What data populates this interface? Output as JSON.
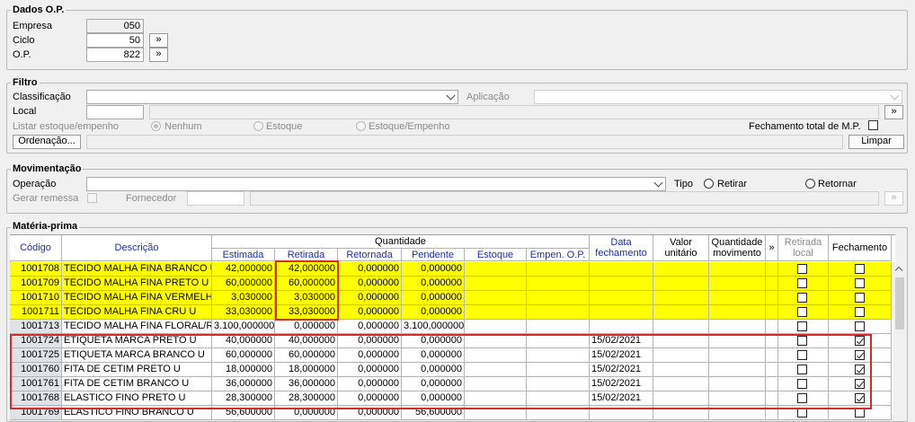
{
  "dados": {
    "title": "Dados O.P.",
    "empresa_label": "Empresa",
    "empresa_value": "050",
    "ciclo_label": "Ciclo",
    "ciclo_value": "50",
    "op_label": "O.P.",
    "op_value": "822",
    "more_label": "»"
  },
  "filtro": {
    "title": "Filtro",
    "classificacao_label": "Classificação",
    "aplicacao_label": "Aplicação",
    "local_label": "Local",
    "listar_label": "Listar estoque/empenho",
    "opt_nenhum": "Nenhum",
    "opt_estoque": "Estoque",
    "opt_estoque_empenho": "Estoque/Empenho",
    "fechamento_total_label": "Fechamento total de M.P.",
    "ordenacao_label": "Ordenação...",
    "limpar_label": "Limpar",
    "more_label": "»"
  },
  "movimentacao": {
    "title": "Movimentação",
    "operacao_label": "Operação",
    "tipo_label": "Tipo",
    "retirar_label": "Retirar",
    "retornar_label": "Retornar",
    "gerar_remessa_label": "Gerar remessa",
    "fornecedor_label": "Fornecedor",
    "more_label": "»"
  },
  "materia": {
    "title": "Matéria-prima",
    "headers": {
      "codigo": "Código",
      "descricao": "Descrição",
      "quantidade": "Quantidade",
      "estimada": "Estimada",
      "retirada": "Retirada",
      "retornada": "Retornada",
      "pendente": "Pendente",
      "estoque": "Estoque",
      "empen_op": "Empen. O.P.",
      "data_fechamento": "Data fechamento",
      "valor_unitario": "Valor unitário",
      "quantidade_movimento": "Quantidade movimento",
      "more": "»",
      "retirada_local": "Retirada local",
      "fechamento": "Fechamento"
    },
    "rows": [
      {
        "codigo": "1001708",
        "descricao": "TECIDO MALHA FINA BRANCO U",
        "estimada": "42,000000",
        "retirada": "42,000000",
        "retornada": "0,000000",
        "pendente": "0,000000",
        "estoque": "",
        "empen": "",
        "data": "",
        "valor": "",
        "qtd_mov": "",
        "highlight": true,
        "fechamento": false
      },
      {
        "codigo": "1001709",
        "descricao": "TECIDO MALHA FINA PRETO U",
        "estimada": "60,000000",
        "retirada": "60,000000",
        "retornada": "0,000000",
        "pendente": "0,000000",
        "estoque": "",
        "empen": "",
        "data": "",
        "valor": "",
        "qtd_mov": "",
        "highlight": true,
        "fechamento": false
      },
      {
        "codigo": "1001710",
        "descricao": "TECIDO MALHA FINA VERMELHO U",
        "estimada": "3,030000",
        "retirada": "3,030000",
        "retornada": "0,000000",
        "pendente": "0,000000",
        "estoque": "",
        "empen": "",
        "data": "",
        "valor": "",
        "qtd_mov": "",
        "highlight": true,
        "fechamento": false
      },
      {
        "codigo": "1001711",
        "descricao": "TECIDO MALHA FINA CRU U",
        "estimada": "33,030000",
        "retirada": "33,030000",
        "retornada": "0,000000",
        "pendente": "0,000000",
        "estoque": "",
        "empen": "",
        "data": "",
        "valor": "",
        "qtd_mov": "",
        "highlight": true,
        "fechamento": false
      },
      {
        "codigo": "1001713",
        "descricao": "TECIDO MALHA FINA FLORAL/ROSA",
        "estimada": "3.100,000000",
        "retirada": "0,000000",
        "retornada": "0,000000",
        "pendente": "3.100,000000",
        "estoque": "",
        "empen": "",
        "data": "",
        "valor": "",
        "qtd_mov": "",
        "highlight": false,
        "fechamento": false
      },
      {
        "codigo": "1001724",
        "descricao": "ETIQUETA MARCA PRETO U",
        "estimada": "40,000000",
        "retirada": "40,000000",
        "retornada": "0,000000",
        "pendente": "0,000000",
        "estoque": "",
        "empen": "",
        "data": "15/02/2021",
        "valor": "",
        "qtd_mov": "",
        "highlight": false,
        "fechamento": true
      },
      {
        "codigo": "1001725",
        "descricao": "ETIQUETA MARCA BRANCO U",
        "estimada": "60,000000",
        "retirada": "60,000000",
        "retornada": "0,000000",
        "pendente": "0,000000",
        "estoque": "",
        "empen": "",
        "data": "15/02/2021",
        "valor": "",
        "qtd_mov": "",
        "highlight": false,
        "fechamento": true
      },
      {
        "codigo": "1001760",
        "descricao": "FITA DE CETIM PRETO U",
        "estimada": "18,000000",
        "retirada": "18,000000",
        "retornada": "0,000000",
        "pendente": "0,000000",
        "estoque": "",
        "empen": "",
        "data": "15/02/2021",
        "valor": "",
        "qtd_mov": "",
        "highlight": false,
        "fechamento": true
      },
      {
        "codigo": "1001761",
        "descricao": "FITA DE CETIM  BRANCO U",
        "estimada": "36,000000",
        "retirada": "36,000000",
        "retornada": "0,000000",
        "pendente": "0,000000",
        "estoque": "",
        "empen": "",
        "data": "15/02/2021",
        "valor": "",
        "qtd_mov": "",
        "highlight": false,
        "fechamento": true
      },
      {
        "codigo": "1001768",
        "descricao": "ELASTICO FINO PRETO U",
        "estimada": "28,300000",
        "retirada": "28,300000",
        "retornada": "0,000000",
        "pendente": "0,000000",
        "estoque": "",
        "empen": "",
        "data": "15/02/2021",
        "valor": "",
        "qtd_mov": "",
        "highlight": false,
        "fechamento": true
      },
      {
        "codigo": "1001769",
        "descricao": "ELASTICO FINO BRANCO U",
        "estimada": "56,600000",
        "retirada": "0,000000",
        "retornada": "0,000000",
        "pendente": "56,600000",
        "estoque": "",
        "empen": "",
        "data": "",
        "valor": "",
        "qtd_mov": "",
        "highlight": false,
        "fechamento": false
      }
    ],
    "colors": {
      "highlight": "#ffff00",
      "selected_code": "#dfe3e8",
      "annotation": "#d62b2b"
    }
  }
}
